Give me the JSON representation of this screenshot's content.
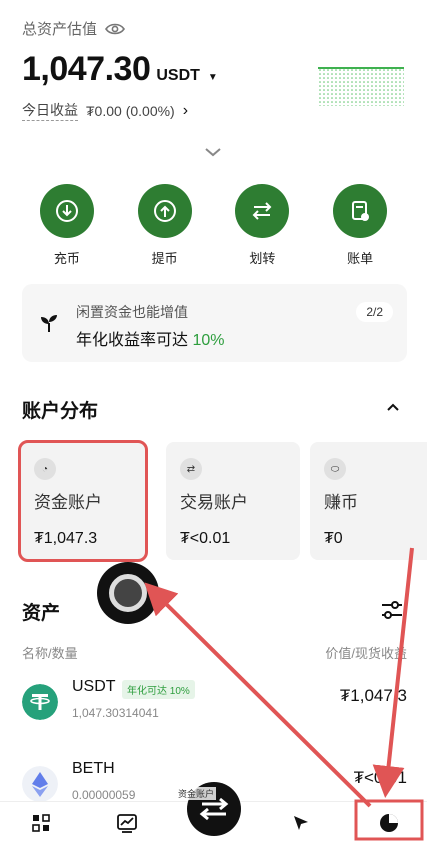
{
  "header": {
    "label": "总资产估值",
    "balance": "1,047.30",
    "currency": "USDT",
    "today_label": "今日收益",
    "today_value": "₮0.00 (0.00%)"
  },
  "actions": [
    {
      "label": "充币",
      "icon": "deposit-icon"
    },
    {
      "label": "提币",
      "icon": "withdraw-icon"
    },
    {
      "label": "划转",
      "icon": "transfer-icon"
    },
    {
      "label": "账单",
      "icon": "bill-icon"
    }
  ],
  "promo": {
    "line1": "闲置资金也能增值",
    "line2_prefix": "年化收益率可达 ",
    "line2_highlight": "10%",
    "pager": "2/2"
  },
  "accounts": {
    "title": "账户分布",
    "items": [
      {
        "name": "资金账户",
        "value": "₮1,047.3",
        "icon": "wallet-icon"
      },
      {
        "name": "交易账户",
        "value": "₮<0.01",
        "icon": "swap-icon"
      },
      {
        "name": "赚币",
        "value": "₮0",
        "icon": "earn-icon"
      }
    ]
  },
  "assets": {
    "title": "资产",
    "col_left": "名称/数量",
    "col_right": "价值/现货收益",
    "rows": [
      {
        "symbol": "USDT",
        "badge": "年化可达 10%",
        "qty": "1,047.30314041",
        "value": "₮1,047.3"
      },
      {
        "symbol": "BETH",
        "badge": "",
        "qty": "0.00000059",
        "value": "₮<0.01"
      }
    ]
  },
  "tooltip": "资金账户",
  "colors": {
    "accent": "#2e7d32",
    "highlight": "#2e9e3e",
    "annotation": "#e05555"
  }
}
